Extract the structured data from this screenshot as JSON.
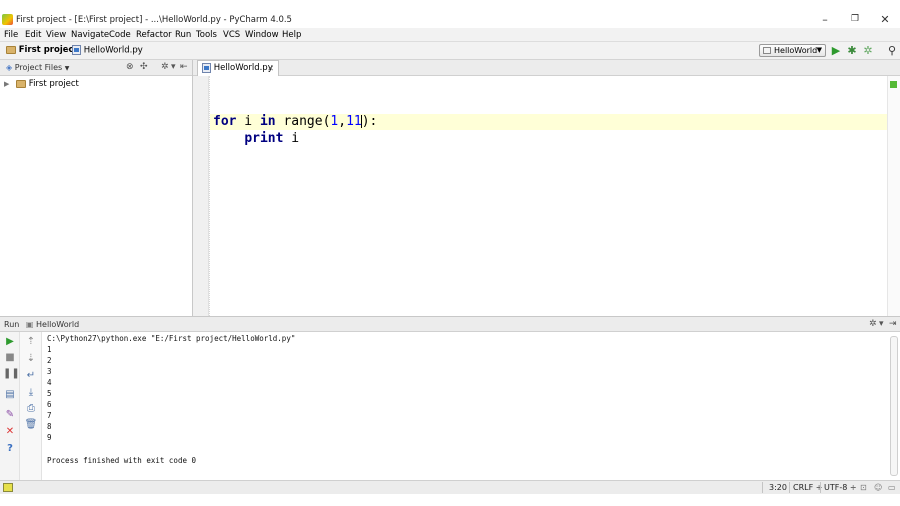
{
  "window": {
    "title": "First project - [E:\\First project] - ...\\HelloWorld.py - PyCharm 4.0.5",
    "minimize": "–",
    "maximize": "❐",
    "close": "✕"
  },
  "menu": [
    "File",
    "Edit",
    "View",
    "Navigate",
    "Code",
    "Refactor",
    "Run",
    "Tools",
    "VCS",
    "Window",
    "Help"
  ],
  "navbar": {
    "project": "First project",
    "file": "HelloWorld.py",
    "run_config": "HelloWorld"
  },
  "project_panel": {
    "title": "Project Files",
    "root": "First project"
  },
  "editor": {
    "tab": "HelloWorld.py",
    "code": {
      "line1": {
        "kw1": "for",
        "t1": " i ",
        "kw2": "in",
        "t2": " range(",
        "n1": "1",
        "t3": ",",
        "n2": "11",
        "t4": "):"
      },
      "line2": {
        "indent": "    ",
        "kw": "print",
        "t": " i"
      }
    }
  },
  "run_panel": {
    "title": "Run",
    "config": "HelloWorld",
    "command": "C:\\Python27\\python.exe \"E:/First project/HelloWorld.py\"",
    "output": [
      "1",
      "2",
      "3",
      "4",
      "5",
      "6",
      "7",
      "8",
      "9"
    ],
    "finished": "Process finished with exit code 0"
  },
  "status": {
    "position": "3:20",
    "line_separator": "CRLF ÷",
    "encoding": "UTF-8 ÷"
  },
  "colors": {
    "keyword": "#000080",
    "number": "#0000ff",
    "current_line": "#ffffd7",
    "run_green": "#3a9a2a"
  }
}
